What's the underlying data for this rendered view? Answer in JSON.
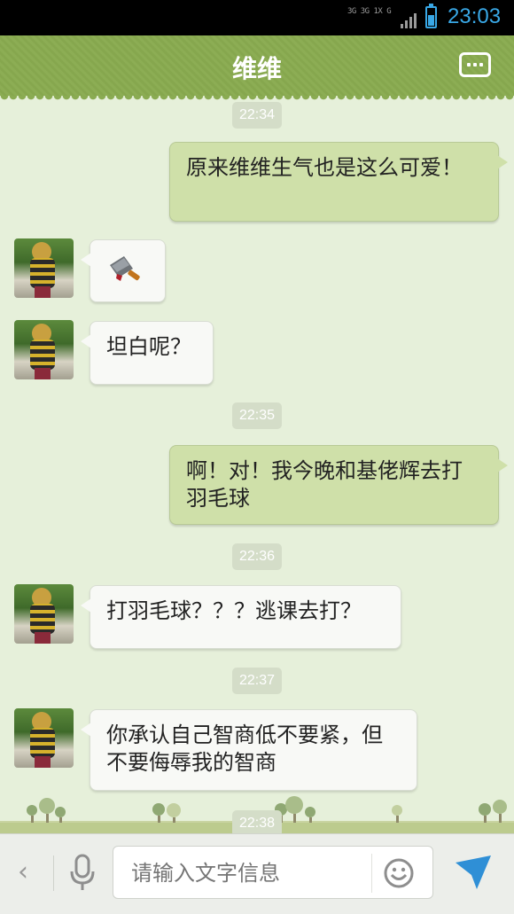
{
  "status_bar": {
    "network": "3G 3G 1X G",
    "time": "23:03"
  },
  "header": {
    "title": "维维",
    "menu_icon": "more-menu-icon"
  },
  "messages": [
    {
      "type": "timestamp",
      "text": "22:34"
    },
    {
      "type": "sent",
      "text": "原来维维生气也是这么可爱！"
    },
    {
      "type": "received",
      "content": "cleaver-emoji-icon"
    },
    {
      "type": "received",
      "text": "坦白呢？"
    },
    {
      "type": "timestamp",
      "text": "22:35"
    },
    {
      "type": "sent",
      "text": "啊！对！我今晚和基佬辉去打羽毛球"
    },
    {
      "type": "timestamp",
      "text": "22:36"
    },
    {
      "type": "received",
      "text": "打羽毛球？？？逃课去打？"
    },
    {
      "type": "timestamp",
      "text": "22:37"
    },
    {
      "type": "received",
      "text": "你承认自己智商低不要紧，但不要侮辱我的智商"
    },
    {
      "type": "timestamp",
      "text": "22:38"
    }
  ],
  "input_bar": {
    "back_icon": "chevron-left-icon",
    "mic_icon": "microphone-icon",
    "placeholder": "请输入文字信息",
    "emoji_icon": "smiley-icon",
    "send_icon": "send-icon"
  },
  "colors": {
    "header_green": "#8cad54",
    "chat_background": "#e6f0da",
    "sent_bubble": "#cfe0a9",
    "received_bubble": "#f8f9f6",
    "status_blue": "#39a8e6"
  }
}
